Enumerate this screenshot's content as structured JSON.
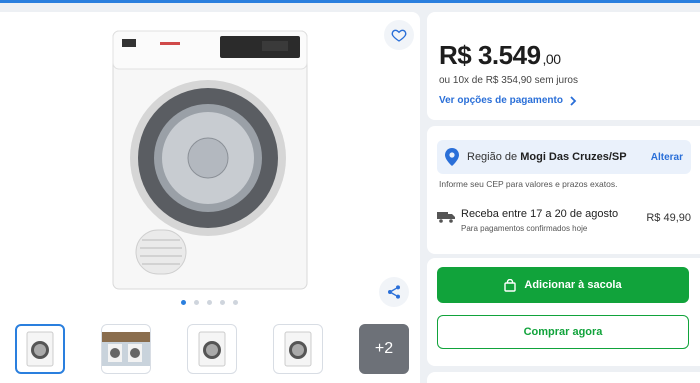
{
  "product": {
    "image_name": "electrolux-dryer",
    "thumb_more": "+2",
    "carousel_count": 5,
    "carousel_active": 0
  },
  "pricing": {
    "price_main": "R$ 3.549",
    "price_cents": ",00",
    "installments": "ou 10x de R$ 354,90 sem juros",
    "payment_link": "Ver opções de pagamento"
  },
  "region": {
    "prefix": "Região de",
    "city": "Mogi Das Cruzes/SP",
    "change": "Alterar",
    "hint": "Informe seu CEP para valores e prazos exatos.",
    "delivery_title": "Receba entre 17 a 20 de agosto",
    "delivery_sub": "Para pagamentos confirmados hoje",
    "delivery_price": "R$ 49,90"
  },
  "actions": {
    "add_to_bag": "Adicionar à sacola",
    "buy_now": "Comprar agora"
  },
  "colors": {
    "accent_blue": "#2a7fde",
    "green": "#11a33b"
  }
}
